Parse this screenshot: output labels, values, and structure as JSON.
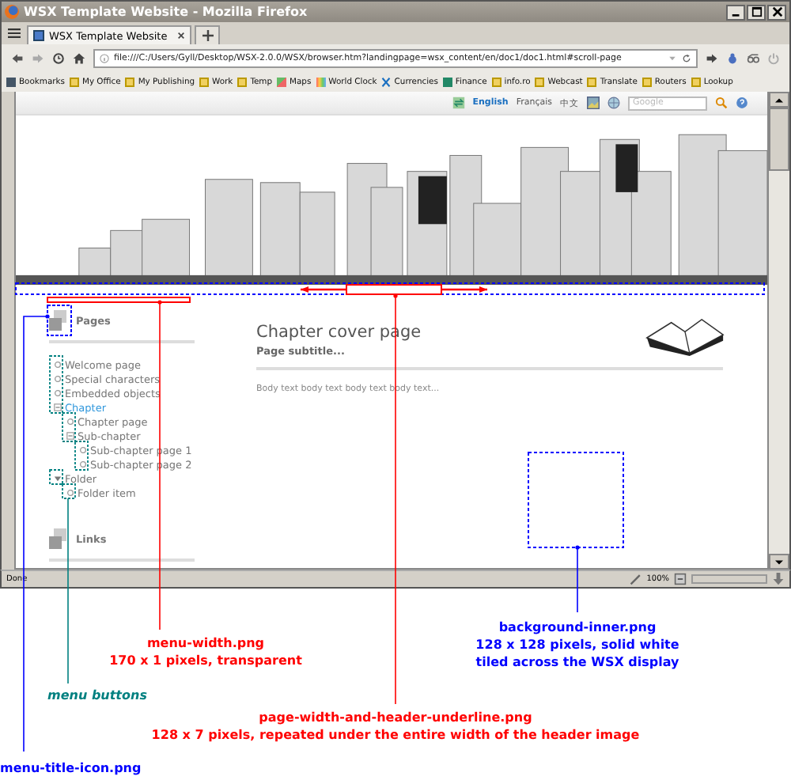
{
  "window": {
    "title": "WSX Template Website - Mozilla Firefox"
  },
  "tabs": [
    {
      "label": "WSX Template Website",
      "selected": true
    }
  ],
  "address": {
    "url": "file:///C:/Users/Gyll/Desktop/WSX-2.0.0/WSX/browser.htm?landingpage=wsx_content/en/doc1/doc1.html#scroll-page"
  },
  "bookmarks": [
    {
      "label": "Bookmarks",
      "kind": "library"
    },
    {
      "label": "My Office",
      "kind": "folder"
    },
    {
      "label": "My Publishing",
      "kind": "folder"
    },
    {
      "label": "Work",
      "kind": "folder"
    },
    {
      "label": "Temp",
      "kind": "folder"
    },
    {
      "label": "Maps",
      "kind": "map"
    },
    {
      "label": "World Clock",
      "kind": "clock"
    },
    {
      "label": "Currencies",
      "kind": "cross"
    },
    {
      "label": "Finance",
      "kind": "square"
    },
    {
      "label": "info.ro",
      "kind": "folder"
    },
    {
      "label": "Webcast",
      "kind": "folder"
    },
    {
      "label": "Translate",
      "kind": "folder"
    },
    {
      "label": "Routers",
      "kind": "folder"
    },
    {
      "label": "Lookup",
      "kind": "folder"
    }
  ],
  "page_toolbar": {
    "languages": [
      {
        "label": "English",
        "selected": true
      },
      {
        "label": "Français",
        "selected": false
      },
      {
        "label": "中文",
        "selected": false
      }
    ],
    "search": {
      "placeholder": "Google"
    }
  },
  "menu": {
    "title": "Pages",
    "links_title": "Links",
    "items": [
      {
        "label": "Welcome page",
        "kind": "page",
        "selected": false
      },
      {
        "label": "Special characters",
        "kind": "page",
        "selected": false
      },
      {
        "label": "Embedded objects",
        "kind": "page",
        "selected": false
      },
      {
        "label": "Chapter",
        "kind": "chapter",
        "expanded": true,
        "selected": true,
        "children": [
          {
            "label": "Chapter page",
            "kind": "page",
            "selected": false
          },
          {
            "label": "Sub-chapter",
            "kind": "chapter",
            "expanded": true,
            "selected": false,
            "children": [
              {
                "label": "Sub-chapter page 1",
                "kind": "page",
                "selected": false
              },
              {
                "label": "Sub-chapter page 2",
                "kind": "page",
                "selected": false
              }
            ]
          }
        ]
      },
      {
        "label": "Folder",
        "kind": "folder",
        "expanded": true,
        "selected": false,
        "children": [
          {
            "label": "Folder item",
            "kind": "page",
            "selected": false
          }
        ]
      }
    ]
  },
  "content": {
    "heading": "Chapter cover page",
    "subtitle": "Page subtitle...",
    "body": "Body text body text body text body text..."
  },
  "status_bar": {
    "text": "Done",
    "zoom": "100%"
  },
  "annotations": [
    {
      "lines": [
        "menu-width.png",
        "170 x 1 pixels, transparent"
      ],
      "color": "#ff0000",
      "italic": false
    },
    {
      "lines": [
        "background-inner.png",
        "128 x 128 pixels, solid white",
        "tiled across the WSX display"
      ],
      "color": "#0000ff",
      "italic": false
    },
    {
      "lines": [
        "menu buttons"
      ],
      "color": "#008080",
      "italic": true
    },
    {
      "lines": [
        "page-width-and-header-underline.png",
        "128 x 7 pixels, repeated under the entire width of the header image"
      ],
      "color": "#ff0000",
      "italic": false
    },
    {
      "lines": [
        "menu-title-icon.png"
      ],
      "color": "#0000ff",
      "italic": false
    }
  ]
}
